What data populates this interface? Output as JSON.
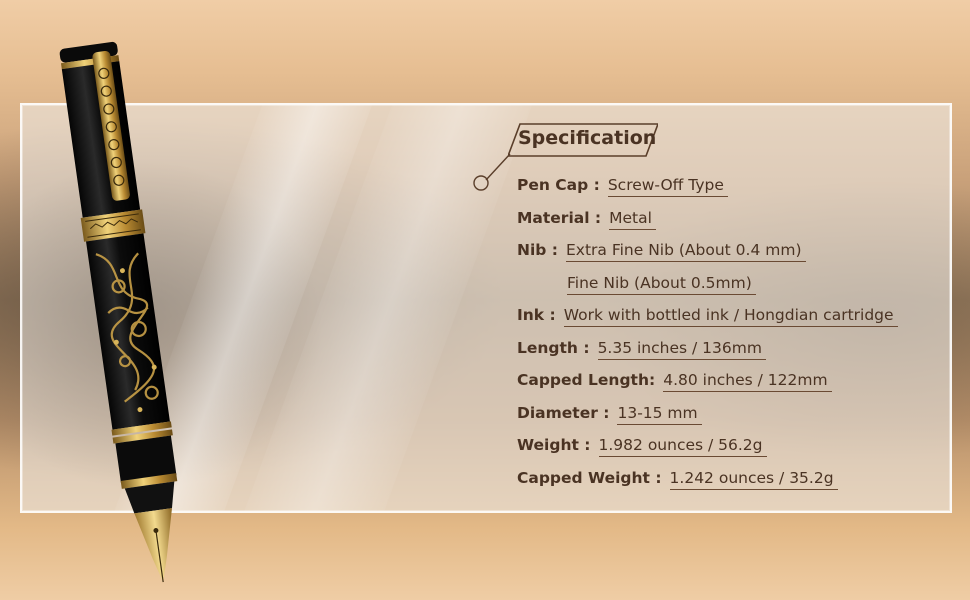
{
  "specification": {
    "title": "Specification",
    "rows": [
      {
        "label": "Pen Cap :",
        "value": "Screw-Off Type"
      },
      {
        "label": "Material :",
        "value": "Metal"
      },
      {
        "label": "Nib :",
        "value": "Extra Fine Nib (About 0.4 mm)"
      },
      {
        "label": "",
        "value": "Fine Nib (About 0.5mm)"
      },
      {
        "label": "Ink :",
        "value": "Work with bottled ink / Hongdian cartridge"
      },
      {
        "label": "Length :",
        "value": "5.35 inches / 136mm"
      },
      {
        "label": "Capped Length:",
        "value": "4.80 inches / 122mm"
      },
      {
        "label": "Diameter :",
        "value": "13-15 mm"
      },
      {
        "label": "Weight :",
        "value": "1.982 ounces / 56.2g"
      },
      {
        "label": "Capped Weight :",
        "value": "1.242 ounces / 35.2g"
      }
    ]
  },
  "colors": {
    "text": "#4a3323",
    "pen_body": "#141414",
    "gold": "#c9a048"
  }
}
